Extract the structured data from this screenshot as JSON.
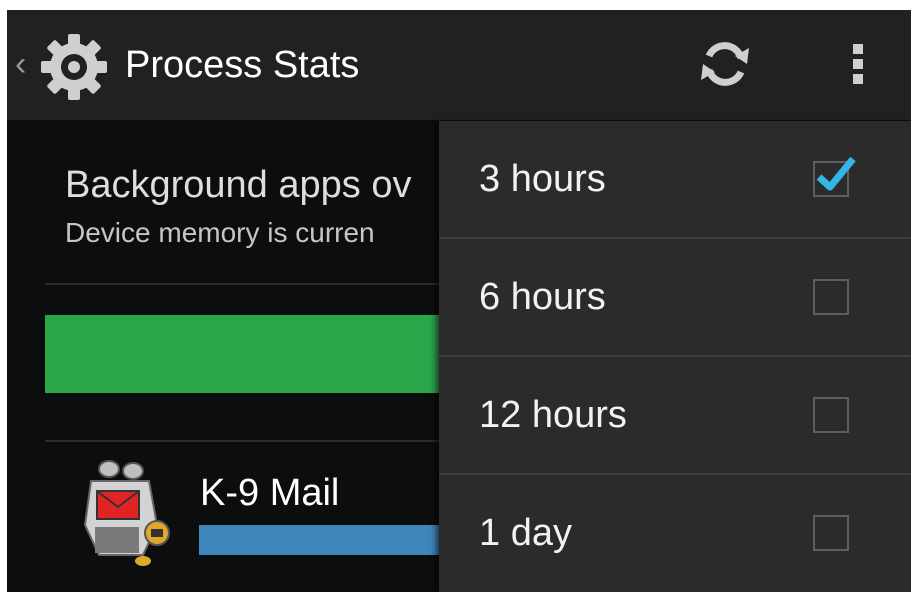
{
  "action_bar": {
    "title": "Process Stats",
    "up_icon": "chevron-left-icon",
    "app_icon": "gear-icon",
    "refresh_icon": "refresh-icon",
    "overflow_icon": "overflow-menu-icon",
    "background": "#212121"
  },
  "summary": {
    "title": "Background apps ov",
    "subtitle": "Device memory is curren"
  },
  "memory_bar": {
    "color": "#2aa64b"
  },
  "app_row": {
    "name": "K-9 Mail",
    "icon": "k9-mail-icon",
    "bar_color": "#3f86bd"
  },
  "duration_menu": {
    "items": [
      {
        "label": "3 hours",
        "checked": true
      },
      {
        "label": "6 hours",
        "checked": false
      },
      {
        "label": "12 hours",
        "checked": false
      },
      {
        "label": "1 day",
        "checked": false
      }
    ],
    "check_color": "#33b5e5"
  }
}
